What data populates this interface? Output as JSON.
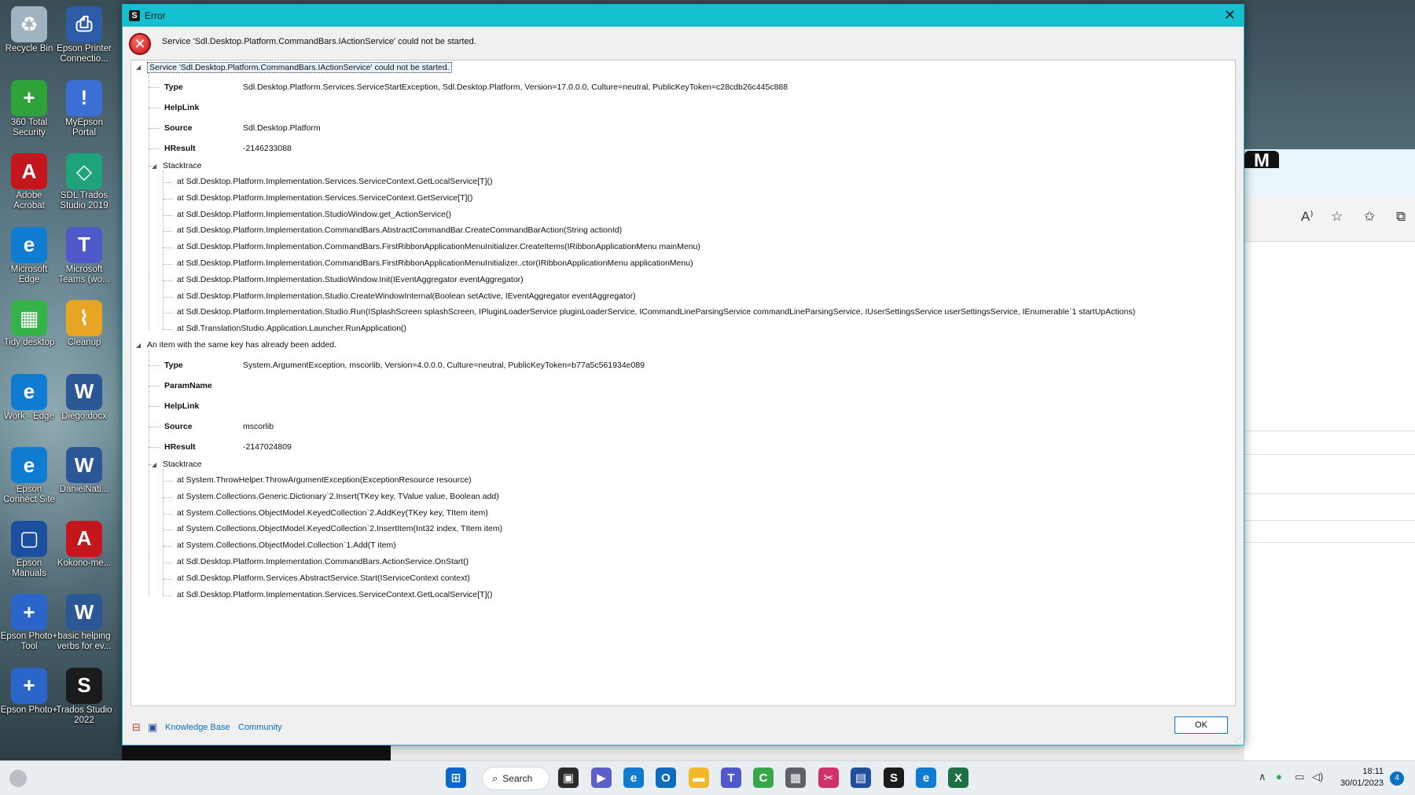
{
  "desktop_icons": [
    {
      "label": "Recycle Bin",
      "icon": "recycle-bin-icon",
      "color": "#9fb3c0"
    },
    {
      "label": "Epson Printer Connectio...",
      "icon": "printer-icon",
      "color": "#2d5da8"
    },
    {
      "label": "360 Total Security",
      "icon": "shield-plus-icon",
      "color": "#2fa23a"
    },
    {
      "label": "MyEpson Portal",
      "icon": "info-bubble-icon",
      "color": "#3b6fd6"
    },
    {
      "label": "Adobe Acrobat",
      "icon": "acrobat-icon",
      "color": "#c4161c"
    },
    {
      "label": "SDL Trados Studio 2019",
      "icon": "trados-2019-icon",
      "color": "#1fa37a"
    },
    {
      "label": "Microsoft Edge",
      "icon": "edge-icon",
      "color": "#0f7bd1"
    },
    {
      "label": "Microsoft Teams (wo...",
      "icon": "teams-icon",
      "color": "#5059c9"
    },
    {
      "label": "Tidy desktop",
      "icon": "tidy-desktop-icon",
      "color": "#35b34a"
    },
    {
      "label": "Cleanup",
      "icon": "broom-icon",
      "color": "#e8a521"
    },
    {
      "label": "Work - Edge",
      "icon": "edge-icon",
      "color": "#0f7bd1"
    },
    {
      "label": "Diego.docx",
      "icon": "word-doc-icon",
      "color": "#2b5797"
    },
    {
      "label": "Epson Connect Site",
      "icon": "edge-icon",
      "color": "#0f7bd1"
    },
    {
      "label": "DanielNati...",
      "icon": "word-doc-icon",
      "color": "#2b5797"
    },
    {
      "label": "Epson Manuals",
      "icon": "manual-icon",
      "color": "#1c4fa0"
    },
    {
      "label": "Kokono-me...",
      "icon": "pdf-icon",
      "color": "#c4161c"
    },
    {
      "label": "Epson Photo+ Tool",
      "icon": "photo-tool-icon",
      "color": "#2a66c9"
    },
    {
      "label": "basic helping verbs for ev...",
      "icon": "word-doc-icon",
      "color": "#2b5797"
    },
    {
      "label": "Epson Photo+",
      "icon": "photo-plus-icon",
      "color": "#2a66c9"
    },
    {
      "label": "Trados Studio 2022",
      "icon": "trados-2022-icon",
      "color": "#1b1b1b"
    }
  ],
  "dialog": {
    "title": "Error",
    "app_icon": "S",
    "close_glyph": "✕",
    "message": "Service 'Sdl.Desktop.Platform.CommandBars.IActionService' could not be started.",
    "tree": {
      "root1": "Service 'Sdl.Desktop.Platform.CommandBars.IActionService' could not be started.",
      "root1_props": [
        {
          "key": "Type",
          "value": "Sdl.Desktop.Platform.Services.ServiceStartException, Sdl.Desktop.Platform, Version=17.0.0.0, Culture=neutral, PublicKeyToken=c28cdb26c445c888"
        },
        {
          "key": "HelpLink",
          "value": ""
        },
        {
          "key": "Source",
          "value": "Sdl.Desktop.Platform"
        },
        {
          "key": "HResult",
          "value": "-2146233088"
        }
      ],
      "stacktrace_label": "Stacktrace",
      "root1_stack": [
        "at Sdl.Desktop.Platform.Implementation.Services.ServiceContext.GetLocalService[T]()",
        "at Sdl.Desktop.Platform.Implementation.Services.ServiceContext.GetService[T]()",
        "at Sdl.Desktop.Platform.Implementation.StudioWindow.get_ActionService()",
        "at Sdl.Desktop.Platform.Implementation.CommandBars.AbstractCommandBar.CreateCommandBarAction(String actionId)",
        "at Sdl.Desktop.Platform.Implementation.CommandBars.FirstRibbonApplicationMenuInitializer.CreateItems(IRibbonApplicationMenu mainMenu)",
        "at Sdl.Desktop.Platform.Implementation.CommandBars.FirstRibbonApplicationMenuInitializer..ctor(IRibbonApplicationMenu applicationMenu)",
        "at Sdl.Desktop.Platform.Implementation.StudioWindow.Init(IEventAggregator eventAggregator)",
        "at Sdl.Desktop.Platform.Implementation.Studio.CreateWindowInternal(Boolean setActive, IEventAggregator eventAggregator)",
        "at Sdl.Desktop.Platform.Implementation.Studio.Run(ISplashScreen splashScreen, IPluginLoaderService pluginLoaderService, ICommandLineParsingService commandLineParsingService, IUserSettingsService userSettingsService, IEnumerable`1 startUpActions)",
        "at Sdl.TranslationStudio.Application.Launcher.RunApplication()"
      ],
      "root2": "An item with the same key has already been added.",
      "root2_props": [
        {
          "key": "Type",
          "value": "System.ArgumentException, mscorlib, Version=4.0.0.0, Culture=neutral, PublicKeyToken=b77a5c561934e089"
        },
        {
          "key": "ParamName",
          "value": ""
        },
        {
          "key": "HelpLink",
          "value": ""
        },
        {
          "key": "Source",
          "value": "mscorlib"
        },
        {
          "key": "HResult",
          "value": "-2147024809"
        }
      ],
      "root2_stack": [
        "at System.ThrowHelper.ThrowArgumentException(ExceptionResource resource)",
        "at System.Collections.Generic.Dictionary`2.Insert(TKey key, TValue value, Boolean add)",
        "at System.Collections.ObjectModel.KeyedCollection`2.AddKey(TKey key, TItem item)",
        "at System.Collections.ObjectModel.KeyedCollection`2.InsertItem(Int32 index, TItem item)",
        "at System.Collections.ObjectModel.Collection`1.Add(T item)",
        "at Sdl.Desktop.Platform.Implementation.CommandBars.ActionService.OnStart()",
        "at Sdl.Desktop.Platform.Services.AbstractService.Start(IServiceContext context)",
        "at Sdl.Desktop.Platform.Implementation.Services.ServiceContext.GetLocalService[T]()"
      ]
    },
    "footer": {
      "knowledge_base": "Knowledge Base",
      "community": "Community",
      "ok": "OK"
    }
  },
  "background_window": {
    "badge": "M"
  },
  "taskbar": {
    "search_label": "Search",
    "apps": [
      {
        "name": "start-button",
        "icon": "windows-logo-icon",
        "color": "#0a67d0",
        "glyph": "⊞"
      },
      {
        "name": "task-view",
        "icon": "task-view-icon",
        "color": "#2b2b2b",
        "glyph": "▣"
      },
      {
        "name": "teams-chat",
        "icon": "chat-icon",
        "color": "#5b5fc7",
        "glyph": "▶"
      },
      {
        "name": "edge",
        "icon": "edge-icon",
        "color": "#0f7bd1",
        "glyph": "e"
      },
      {
        "name": "outlook",
        "icon": "outlook-icon",
        "color": "#0f6cbd",
        "glyph": "O"
      },
      {
        "name": "file-explorer",
        "icon": "folder-icon",
        "color": "#f2b928",
        "glyph": "▬"
      },
      {
        "name": "teams",
        "icon": "teams-icon",
        "color": "#5059c9",
        "glyph": "T"
      },
      {
        "name": "ccleaner",
        "icon": "ccleaner-icon",
        "color": "#3aa64a",
        "glyph": "C"
      },
      {
        "name": "calculator",
        "icon": "calculator-icon",
        "color": "#5d6168",
        "glyph": "▦"
      },
      {
        "name": "snipping-tool",
        "icon": "scissors-icon",
        "color": "#d0306b",
        "glyph": "✂"
      },
      {
        "name": "epson-scan",
        "icon": "scanner-icon",
        "color": "#1f4f9d",
        "glyph": "▤"
      },
      {
        "name": "trados",
        "icon": "trados-icon",
        "color": "#1b1b1b",
        "glyph": "S"
      },
      {
        "name": "edge-work",
        "icon": "edge-icon",
        "color": "#0f7bd1",
        "glyph": "e"
      },
      {
        "name": "excel",
        "icon": "excel-icon",
        "color": "#1d7044",
        "glyph": "X"
      }
    ],
    "time": "18:11",
    "date": "30/01/2023",
    "notification_count": "4"
  }
}
